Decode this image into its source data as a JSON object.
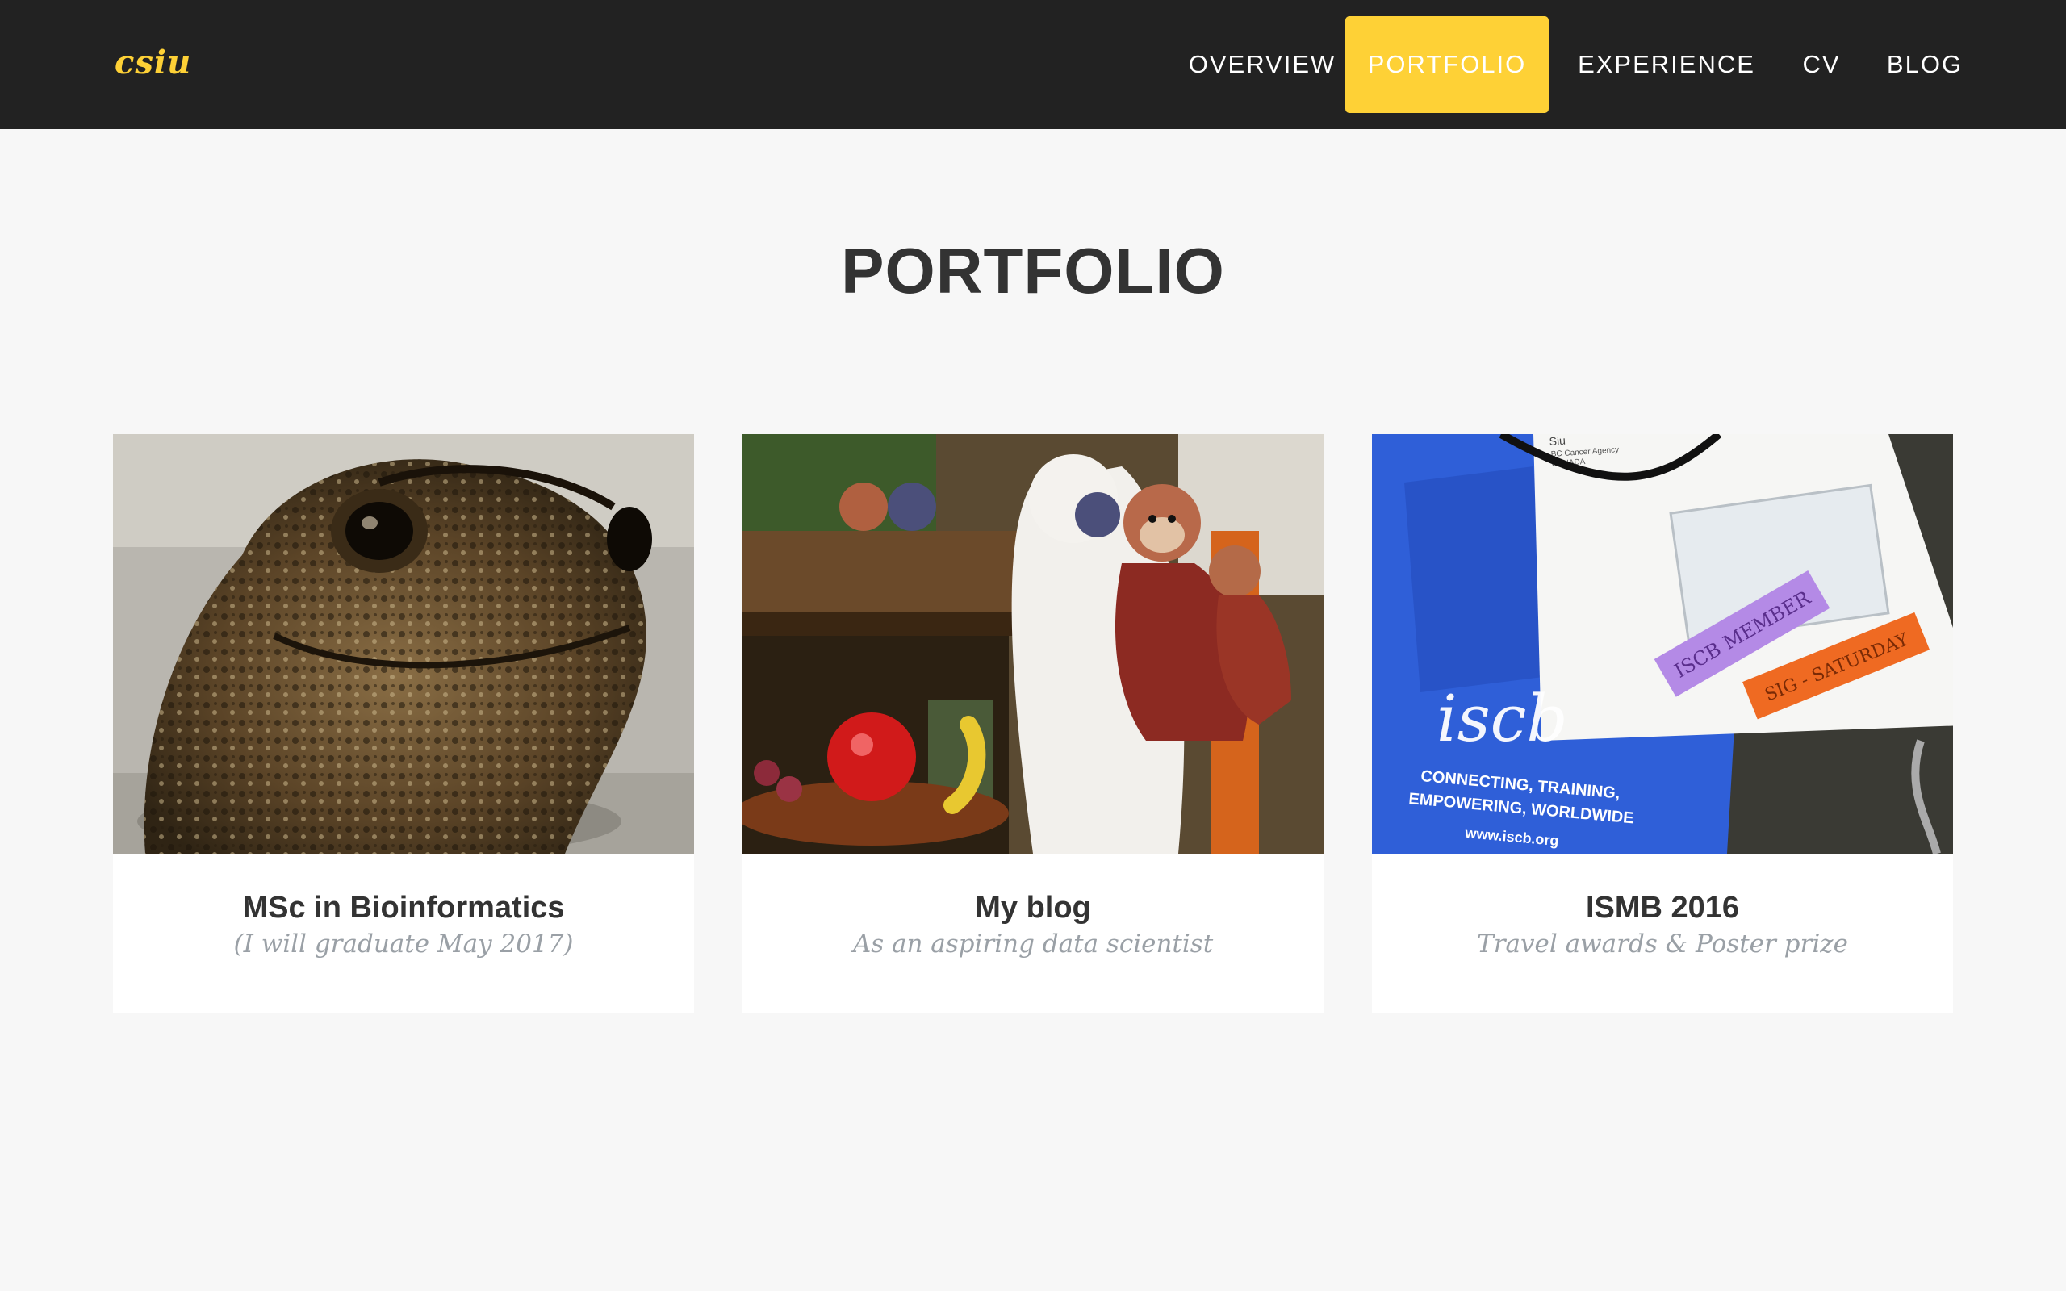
{
  "brand": "csiu",
  "nav": {
    "items": [
      {
        "label": "Overview",
        "active": false
      },
      {
        "label": "Portfolio",
        "active": true
      },
      {
        "label": "Experience",
        "active": false
      },
      {
        "label": "CV",
        "active": false
      },
      {
        "label": "Blog",
        "active": false
      }
    ]
  },
  "section": {
    "title": "PORTFOLIO"
  },
  "portfolio": {
    "items": [
      {
        "title": "MSc in Bioinformatics",
        "subtitle": "(I will graduate May 2017)",
        "image": "toad-photo"
      },
      {
        "title": "My blog",
        "subtitle": "As an aspiring data scientist",
        "image": "stuffed-monkeys-photo"
      },
      {
        "title": "ISMB 2016",
        "subtitle": "Travel awards & Poster prize",
        "image": "conference-badge-photo",
        "photo_text": {
          "bag_logo": "iscb",
          "bag_line1": "CONNECTING, TRAINING,",
          "bag_line2": "EMPOWERING, WORLDWIDE",
          "bag_url": "www.iscb.org",
          "badge_name": "Siu",
          "badge_org": "BC Cancer Agency",
          "badge_country": "CANADA",
          "ribbon1": "ISCB MEMBER",
          "ribbon2": "SIG - SATURDAY"
        }
      }
    ]
  },
  "colors": {
    "nav_bg": "#222222",
    "accent": "#fed136",
    "page_bg": "#f7f7f7",
    "heading": "#333333",
    "muted": "#9aa0a6"
  }
}
